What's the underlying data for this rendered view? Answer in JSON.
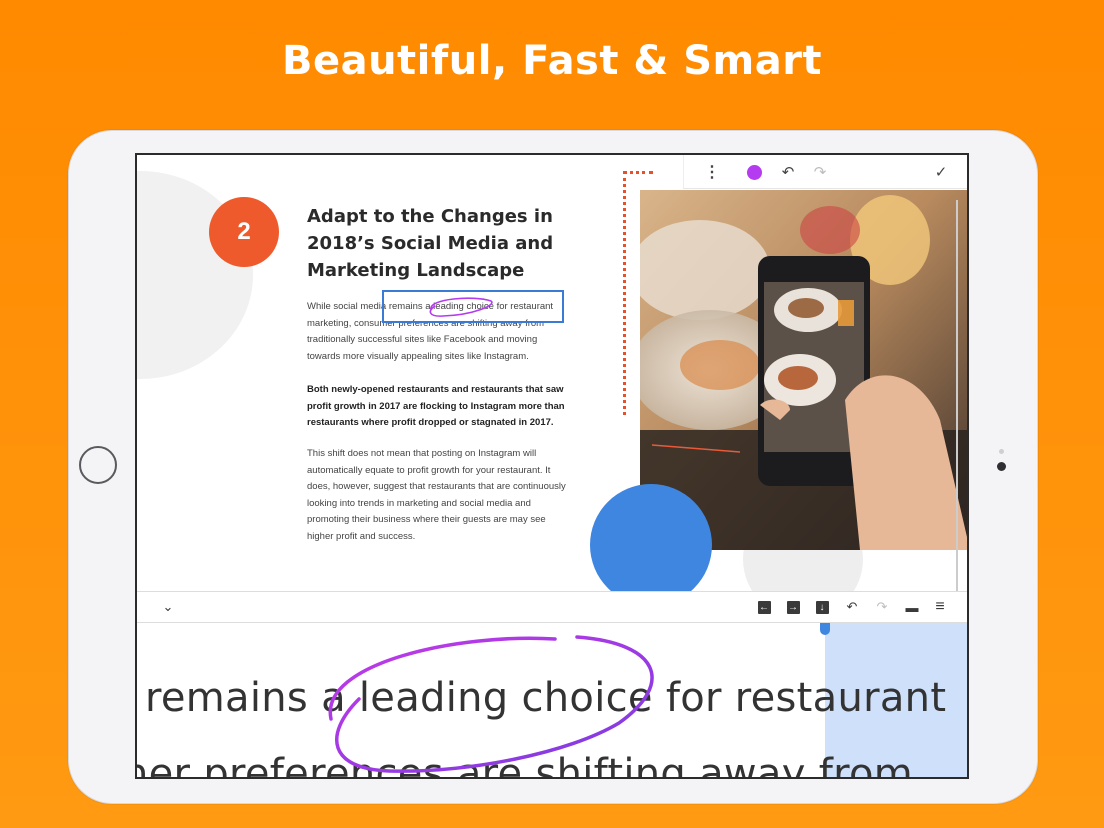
{
  "headline": "Beautiful, Fast & Smart",
  "document": {
    "section_number": "2",
    "heading": "Adapt to the Changes in 2018’s Social Media and Marketing Landscape",
    "paragraph1": "While social media remains a leading choice for restaurant marketing, consumer preferences are shifting away from traditionally successful sites like Facebook and moving towards more visually appealing sites like Instagram.",
    "paragraph2": "Both newly-opened restaurants and restaurants that saw profit growth in 2017 are flocking to Instagram more than restaurants where profit dropped or stagnated in 2017.",
    "paragraph3": "This shift does not mean that posting on Instagram will automatically equate to profit growth for your restaurant. It does, however, suggest that restaurants that are continuously looking into trends in marketing and social media and promoting their business where their guests are may see higher profit and success."
  },
  "top_toolbar": {
    "menu_icon": "⋮",
    "pen_color": "#b43bf0",
    "undo_icon": "↶",
    "redo_icon": "↷",
    "done_icon": "✓"
  },
  "bottom_toolbar": {
    "collapse_icon": "⌄",
    "move_left_icon": "←",
    "move_right_icon": "→",
    "move_down_icon": "↓",
    "undo_icon": "↶",
    "redo_icon": "↷",
    "panel_icon": "▬",
    "menu_icon": "≡"
  },
  "zoom_view": {
    "line1": "remains a leading choice for restaurant",
    "line2": "ner preferences are shifting away from"
  }
}
